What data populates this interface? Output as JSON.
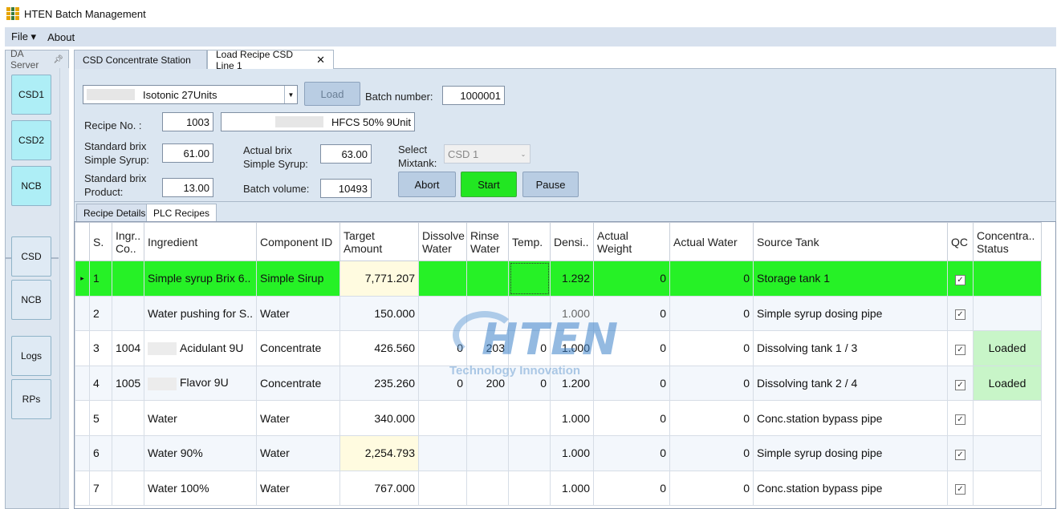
{
  "window": {
    "title": "HTEN Batch Management"
  },
  "menu": {
    "file": "File ▾",
    "about": "About"
  },
  "left_panel": {
    "header": "DA Server",
    "pin_icon": "pin-icon",
    "buttons": [
      "CSD1",
      "CSD2",
      "NCB",
      "CSD",
      "NCB",
      "Logs",
      "RPs"
    ]
  },
  "tabs": [
    {
      "label": "CSD Concentrate Station",
      "active": false
    },
    {
      "label": "Load Recipe CSD Line 1",
      "active": true,
      "close": "✕"
    }
  ],
  "form": {
    "recipe_select": "Isotonic 27Units",
    "load_label": "Load",
    "batch_number_label": "Batch number:",
    "batch_number": "1000001",
    "recipe_no_label": "Recipe No. :",
    "recipe_no": "1003",
    "recipe_name": "HFCS 50% 9Unit",
    "std_brix_syrup_label_1": "Standard brix",
    "std_brix_syrup_label_2": "Simple Syrup:",
    "std_brix_syrup": "61.00",
    "actual_brix_label_1": "Actual brix",
    "actual_brix_label_2": "Simple Syrup:",
    "actual_brix": "63.00",
    "select_mixtank_label_1": "Select",
    "select_mixtank_label_2": "Mixtank:",
    "mixtank": "CSD 1",
    "std_brix_product_label_1": "Standard brix",
    "std_brix_product_label_2": "Product:",
    "std_brix_product": "13.00",
    "batch_volume_label": "Batch volume:",
    "batch_volume": "10493",
    "abort_label": "Abort",
    "start_label": "Start",
    "pause_label": "Pause"
  },
  "subtabs": [
    {
      "label": "Recipe Details",
      "active": false
    },
    {
      "label": "PLC Recipes",
      "active": true
    }
  ],
  "table": {
    "headers": [
      "S.",
      "Ingr.. Co..",
      "Ingredient",
      "Component ID",
      "Target Amount",
      "Dissolve Water",
      "Rinse Water",
      "Temp.",
      "Densi..",
      "Actual Weight",
      "Actual Water",
      "Source Tank",
      "QC",
      "Concentra.. Status"
    ],
    "rows": [
      {
        "s": "1",
        "code": "",
        "ingredient": "Simple syrup Brix 6..",
        "component": "Simple Sirup",
        "target": "7,771.207",
        "dissolve": "",
        "rinse": "",
        "temp": "",
        "density": "1.292",
        "actual_weight": "0",
        "actual_water": "0",
        "source": "Storage tank 1",
        "qc": "✓",
        "status": ""
      },
      {
        "s": "2",
        "code": "",
        "ingredient": "Water pushing for S..",
        "component": "Water",
        "target": "150.000",
        "dissolve": "",
        "rinse": "",
        "temp": "",
        "density": "1.000",
        "actual_weight": "0",
        "actual_water": "0",
        "source": "Simple syrup dosing pipe",
        "qc": "✓",
        "status": ""
      },
      {
        "s": "3",
        "code": "1004",
        "ingredient": "Acidulant 9U",
        "component": "Concentrate",
        "target": "426.560",
        "dissolve": "0",
        "rinse": "203",
        "temp": "0",
        "density": "1.000",
        "actual_weight": "0",
        "actual_water": "0",
        "source": "Dissolving tank 1 / 3",
        "qc": "✓",
        "status": "Loaded"
      },
      {
        "s": "4",
        "code": "1005",
        "ingredient": "Flavor 9U",
        "component": "Concentrate",
        "target": "235.260",
        "dissolve": "0",
        "rinse": "200",
        "temp": "0",
        "density": "1.200",
        "actual_weight": "0",
        "actual_water": "0",
        "source": "Dissolving tank 2 / 4",
        "qc": "✓",
        "status": "Loaded"
      },
      {
        "s": "5",
        "code": "",
        "ingredient": "Water",
        "component": "Water",
        "target": "340.000",
        "dissolve": "",
        "rinse": "",
        "temp": "",
        "density": "1.000",
        "actual_weight": "0",
        "actual_water": "0",
        "source": "Conc.station bypass pipe",
        "qc": "✓",
        "status": ""
      },
      {
        "s": "6",
        "code": "",
        "ingredient": "Water 90%",
        "component": "Water",
        "target": "2,254.793",
        "dissolve": "",
        "rinse": "",
        "temp": "",
        "density": "1.000",
        "actual_weight": "0",
        "actual_water": "0",
        "source": "Simple syrup dosing pipe",
        "qc": "✓",
        "status": ""
      },
      {
        "s": "7",
        "code": "",
        "ingredient": "Water 100%",
        "component": "Water",
        "target": "767.000",
        "dissolve": "",
        "rinse": "",
        "temp": "",
        "density": "1.000",
        "actual_weight": "0",
        "actual_water": "0",
        "source": "Conc.station bypass pipe",
        "qc": "✓",
        "status": ""
      }
    ],
    "row_indicator": "▸"
  },
  "watermark": {
    "brand": "HTEN",
    "tagline": "Technology Innovation"
  },
  "colors": {
    "highlight_row": "#26f126",
    "start_button": "#22e622",
    "loaded_cell": "#c8f5c8",
    "nav_button": "#aeeef6"
  }
}
